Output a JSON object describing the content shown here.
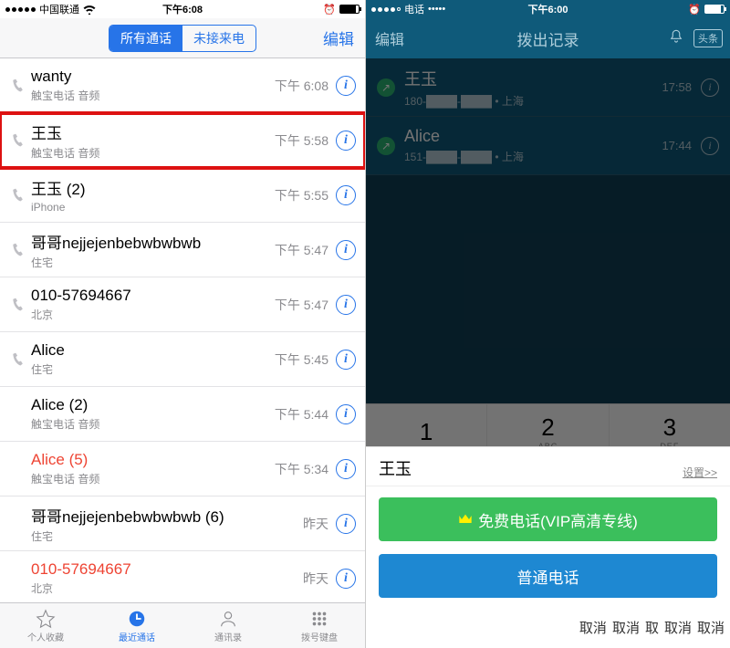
{
  "left": {
    "status": {
      "carrier": "中国联通",
      "wifi": true,
      "time": "下午6:08"
    },
    "segmented": {
      "all": "所有通话",
      "missed": "未接来电"
    },
    "edit": "编辑",
    "calls": [
      {
        "name": "wanty",
        "sub": "触宝电话 音频",
        "time": "下午 6:08",
        "outgoing": true,
        "missed": false,
        "highlight": false
      },
      {
        "name": "王玉",
        "sub": "触宝电话 音频",
        "time": "下午 5:58",
        "outgoing": true,
        "missed": false,
        "highlight": true
      },
      {
        "name": "王玉 (2)",
        "sub": "iPhone",
        "time": "下午 5:55",
        "outgoing": true,
        "missed": false,
        "highlight": false
      },
      {
        "name": "哥哥nejjejenbebwbwbwb",
        "sub": "住宅",
        "time": "下午 5:47",
        "outgoing": true,
        "missed": false,
        "highlight": false
      },
      {
        "name": "010-57694667",
        "sub": "北京",
        "time": "下午 5:47",
        "outgoing": true,
        "missed": false,
        "highlight": false
      },
      {
        "name": "Alice",
        "sub": "住宅",
        "time": "下午 5:45",
        "outgoing": true,
        "missed": false,
        "highlight": false
      },
      {
        "name": "Alice (2)",
        "sub": "触宝电话 音频",
        "time": "下午 5:44",
        "outgoing": false,
        "missed": false,
        "highlight": false
      },
      {
        "name": "Alice (5)",
        "sub": "触宝电话 音频",
        "time": "下午 5:34",
        "outgoing": false,
        "missed": true,
        "highlight": false
      },
      {
        "name": "哥哥nejjejenbebwbwbwb (6)",
        "sub": "住宅",
        "time": "昨天",
        "outgoing": false,
        "missed": false,
        "highlight": false
      },
      {
        "name": "010-57694667",
        "sub": "北京",
        "time": "昨天",
        "outgoing": false,
        "missed": true,
        "highlight": false
      }
    ],
    "tabs": {
      "fav": "个人收藏",
      "recent": "最近通话",
      "contacts": "通讯录",
      "keypad": "拨号键盘"
    }
  },
  "right": {
    "status": {
      "carrier": "电话",
      "time": "下午6:00"
    },
    "header": {
      "back": "编辑",
      "title": "拨出记录",
      "headline": "头条"
    },
    "records": [
      {
        "name": "王玉",
        "sub": "180-████-████ • 上海",
        "time": "17:58"
      },
      {
        "name": "Alice",
        "sub": "151-████-████ • 上海",
        "time": "17:44"
      }
    ],
    "keys": [
      {
        "n": "1",
        "l": ""
      },
      {
        "n": "2",
        "l": "ABC"
      },
      {
        "n": "3",
        "l": "DEF"
      }
    ],
    "sheet": {
      "name": "王玉",
      "settings": "设置>>",
      "free_call": "免费电话(VIP高清专线)",
      "normal_call": "普通电话",
      "cancels": [
        "取消",
        "取消",
        "取",
        "取消",
        "取消"
      ]
    }
  }
}
